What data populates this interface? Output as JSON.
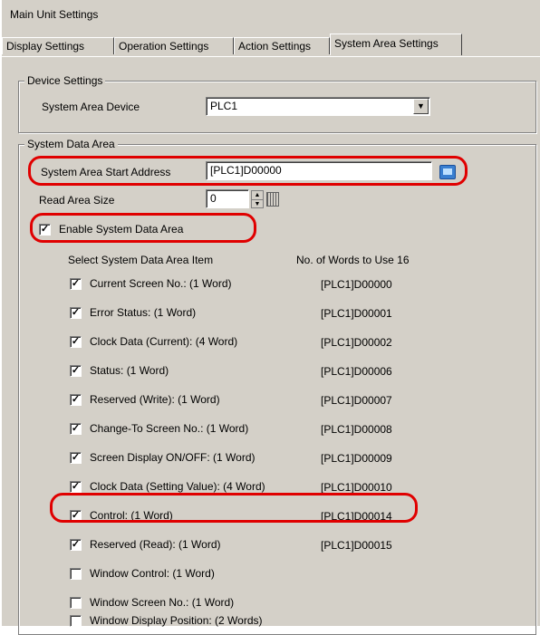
{
  "window": {
    "title": "Main Unit Settings"
  },
  "tabs": [
    {
      "label": "Display Settings",
      "active": false
    },
    {
      "label": "Operation Settings",
      "active": false
    },
    {
      "label": "Action Settings",
      "active": false
    },
    {
      "label": "System Area Settings",
      "active": true
    }
  ],
  "device_settings": {
    "group_label": "Device Settings",
    "system_area_device_label": "System Area Device",
    "system_area_device_value": "PLC1"
  },
  "system_data_area": {
    "group_label": "System Data Area",
    "start_address_label": "System Area Start Address",
    "start_address_value": "[PLC1]D00000",
    "read_area_size_label": "Read Area Size",
    "read_area_size_value": "0",
    "enable_label": "Enable System Data Area",
    "enable_checked": true,
    "select_item_header": "Select System Data Area Item",
    "words_header": "No. of Words to Use 16",
    "items": [
      {
        "label": "Current Screen No.: (1 Word)",
        "address": "[PLC1]D00000",
        "checked": true
      },
      {
        "label": "Error Status: (1 Word)",
        "address": "[PLC1]D00001",
        "checked": true
      },
      {
        "label": "Clock Data (Current): (4 Word)",
        "address": "[PLC1]D00002",
        "checked": true
      },
      {
        "label": "Status: (1 Word)",
        "address": "[PLC1]D00006",
        "checked": true
      },
      {
        "label": "Reserved (Write): (1 Word)",
        "address": "[PLC1]D00007",
        "checked": true
      },
      {
        "label": "Change-To Screen No.: (1 Word)",
        "address": "[PLC1]D00008",
        "checked": true
      },
      {
        "label": "Screen Display ON/OFF: (1 Word)",
        "address": "[PLC1]D00009",
        "checked": true
      },
      {
        "label": "Clock Data (Setting Value): (4 Word)",
        "address": "[PLC1]D00010",
        "checked": true
      },
      {
        "label": "Control: (1 Word)",
        "address": "[PLC1]D00014",
        "checked": true
      },
      {
        "label": "Reserved (Read): (1 Word)",
        "address": "[PLC1]D00015",
        "checked": true
      },
      {
        "label": "Window Control: (1 Word)",
        "address": "",
        "checked": false
      },
      {
        "label": "Window Screen No.: (1 Word)",
        "address": "",
        "checked": false
      },
      {
        "label": "Window Display Position: (2 Words)",
        "address": "",
        "checked": false
      }
    ]
  },
  "colors": {
    "highlight": "#e00000",
    "panel": "#d4d0c8"
  }
}
